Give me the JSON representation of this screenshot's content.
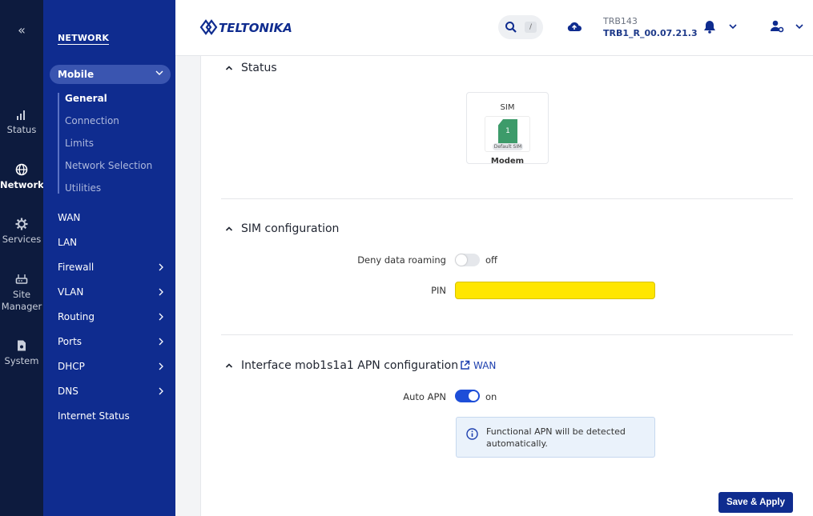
{
  "rail": {
    "items": [
      {
        "label": "Status"
      },
      {
        "label": "Network"
      },
      {
        "label": "Services"
      },
      {
        "label": "Site Manager"
      },
      {
        "label": "System"
      }
    ]
  },
  "sidebar": {
    "heading": "NETWORK",
    "mobile": {
      "label": "Mobile",
      "sub": [
        "General",
        "Connection",
        "Limits",
        "Network Selection",
        "Utilities"
      ]
    },
    "items": [
      "WAN",
      "LAN",
      "Firewall",
      "VLAN",
      "Routing",
      "Ports",
      "DHCP",
      "DNS",
      "Internet Status"
    ]
  },
  "header": {
    "brand": "TELTONIKA",
    "search_key": "/",
    "device_model": "TRB143",
    "firmware": "TRB1_R_00.07.21.3"
  },
  "status": {
    "title": "Status",
    "sim_label": "SIM",
    "sim_number": "1",
    "default_sim": "Default SIM",
    "modem": "Modem"
  },
  "sim_config": {
    "title": "SIM configuration",
    "deny_roaming_label": "Deny data roaming",
    "deny_roaming_state": "off",
    "pin_label": "PIN",
    "pin_value": ""
  },
  "apn": {
    "title": "Interface mob1s1a1 APN configuration",
    "wan_link": "WAN",
    "auto_apn_label": "Auto APN",
    "auto_apn_state": "on",
    "info": "Functional APN will be detected automatically."
  },
  "actions": {
    "save_apply": "Save & Apply"
  },
  "colors": {
    "rail_bg": "#0d1b3e",
    "sidebar_bg": "#0f2c8f",
    "accent": "#1d4ed8",
    "pin_highlight": "#ffe600",
    "sim_green": "#3d9b6a"
  }
}
